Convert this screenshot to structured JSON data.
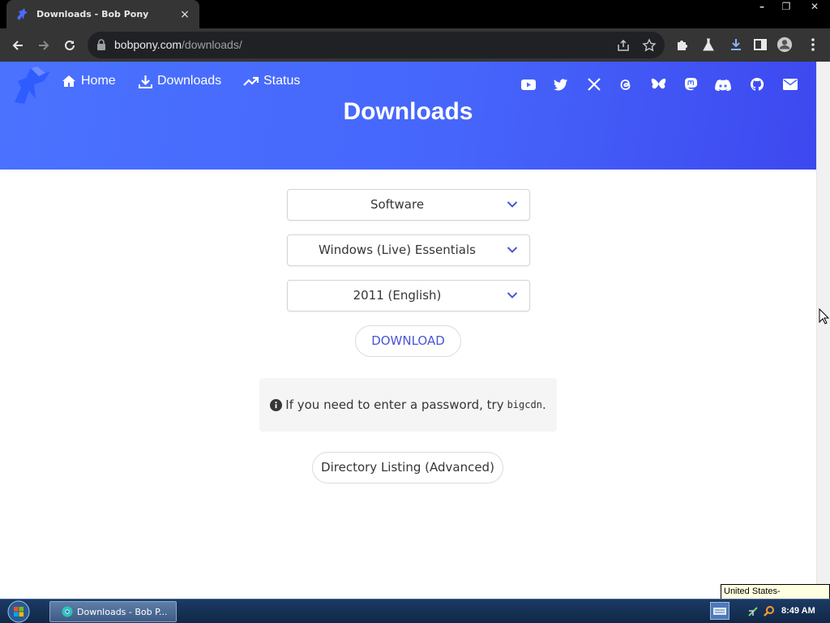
{
  "browser": {
    "tab_title": "Downloads - Bob Pony",
    "tab_close": "×",
    "url_host": "bobpony.com",
    "url_path": "/downloads/",
    "window_controls": {
      "minimize": "–",
      "restore": "❐",
      "close": "✕"
    }
  },
  "site": {
    "nav": [
      {
        "label": "Home",
        "icon": "home-icon"
      },
      {
        "label": "Downloads",
        "icon": "download-icon"
      },
      {
        "label": "Status",
        "icon": "trending-up-icon"
      }
    ],
    "social_icons": [
      "youtube-icon",
      "twitter-icon",
      "x-icon",
      "threads-icon",
      "bluesky-icon",
      "mastodon-icon",
      "discord-icon",
      "github-icon",
      "email-icon"
    ],
    "hero_title": "Downloads",
    "brand_color": "#4a6bff",
    "accent_color": "#4a55d6"
  },
  "form": {
    "category_select": "Software",
    "product_select": "Windows (Live) Essentials",
    "version_select": "2011 (English)",
    "download_button": "DOWNLOAD",
    "notice_text": "If you need to enter a password, try",
    "notice_code": "bigcdn",
    "notice_end": ".",
    "directory_button": "Directory Listing (Advanced)"
  },
  "taskbar": {
    "task_label": "Downloads - Bob P...",
    "clock": "8:49 AM",
    "keyboard_tooltip": "United States-International"
  }
}
